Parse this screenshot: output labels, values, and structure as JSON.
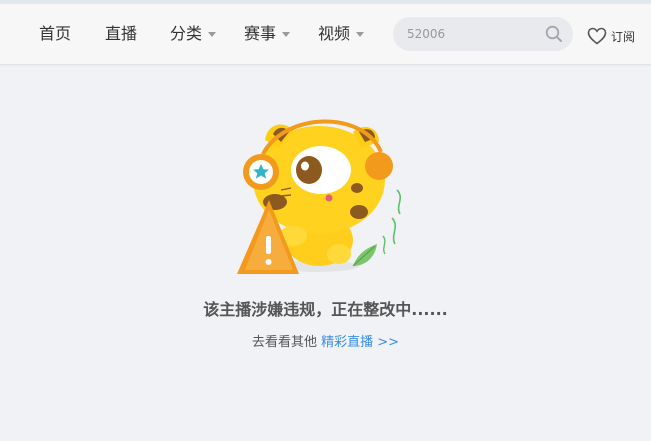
{
  "nav": {
    "items": [
      {
        "label": "首页"
      },
      {
        "label": "直播"
      },
      {
        "label": "分类"
      },
      {
        "label": "赛事"
      },
      {
        "label": "视频"
      }
    ]
  },
  "search": {
    "value": "52006"
  },
  "subscribe": {
    "label": "订阅",
    "icon": "heart-outline-icon"
  },
  "notice": {
    "message": "该主播涉嫌违规，正在整改中......",
    "prompt": "去看看其他",
    "link_label": "精彩直播 >>"
  },
  "colors": {
    "link": "#3a8ee6",
    "mascot_yellow": "#ffd21f",
    "warning_orange": "#f39a1c"
  }
}
